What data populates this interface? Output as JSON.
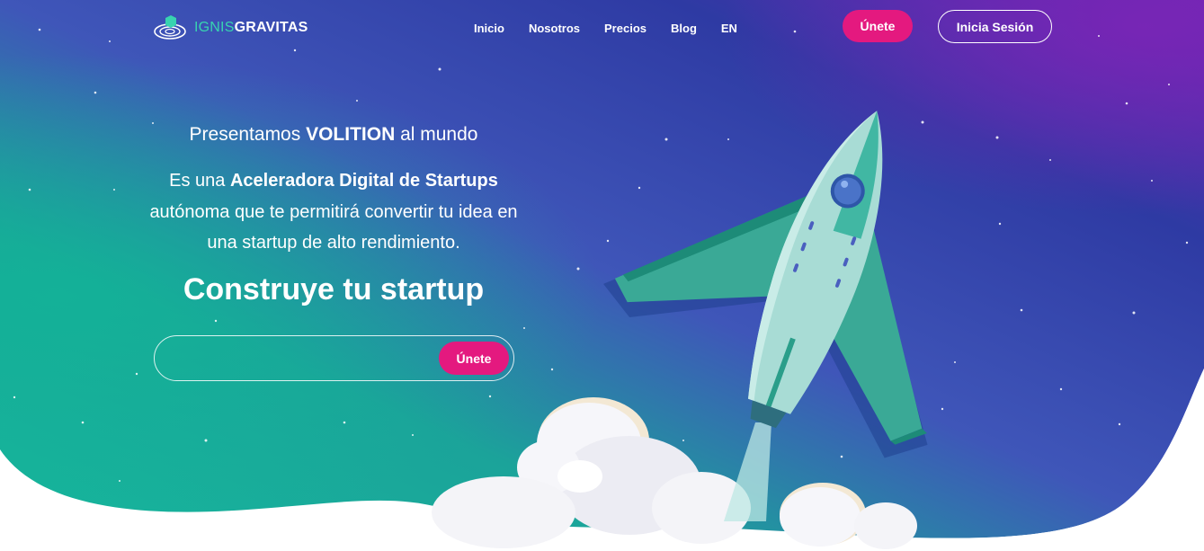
{
  "brand": {
    "logo_part1": "IGNIS",
    "logo_part2": "GRAVITAS",
    "accent_color": "#e4197f",
    "logo_color": "#38d3b0"
  },
  "nav": {
    "items": [
      {
        "label": "Inicio"
      },
      {
        "label": "Nosotros"
      },
      {
        "label": "Precios"
      },
      {
        "label": "Blog"
      },
      {
        "label": "EN"
      }
    ]
  },
  "header": {
    "join_label": "Únete",
    "login_label": "Inicia Sesión"
  },
  "hero": {
    "intro_pre": "Presentamos ",
    "intro_bold": "VOLITION",
    "intro_post": " al mundo",
    "desc_pre": "Es una ",
    "desc_bold": "Aceleradora Digital de Startups",
    "desc_post": " autónoma que te permitirá convertir tu idea en una startup de alto rendimiento.",
    "headline": "Construye tu startup",
    "form": {
      "input_value": "",
      "input_placeholder": "",
      "join_label": "Únete"
    }
  },
  "icons": {
    "logo": "spiral-orbit-logo-icon",
    "illustration": "rocket-launch-illustration"
  }
}
